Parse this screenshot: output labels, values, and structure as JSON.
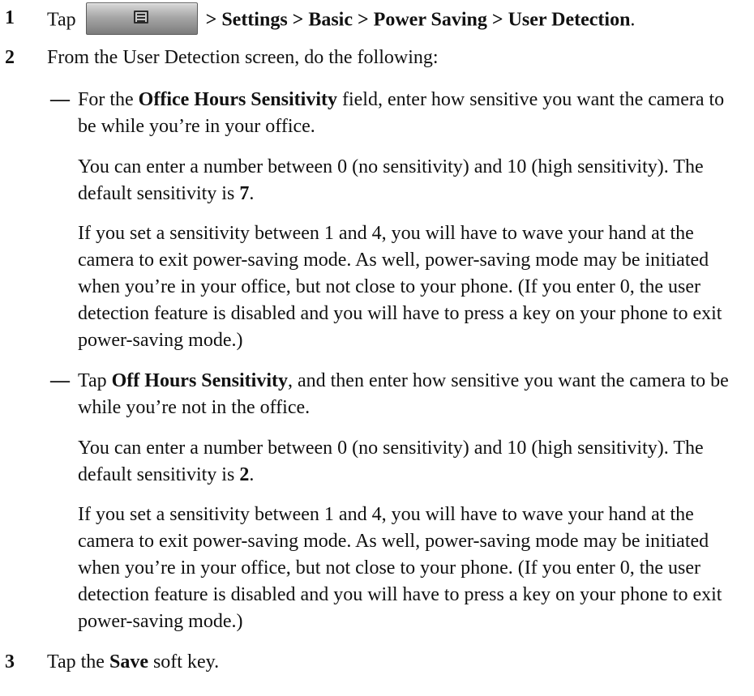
{
  "steps": {
    "s1": {
      "num": "1",
      "tap": "Tap",
      "path": "> Settings > Basic > Power Saving > User Detection",
      "end": ".",
      "button_icon": "menu-list-icon"
    },
    "s2": {
      "num": "2",
      "text": "From the User Detection screen, do the following:"
    },
    "s3": {
      "num": "3",
      "pre": "Tap the",
      "bold": "Save",
      "post": "soft key."
    }
  },
  "bullets": {
    "office": {
      "dash": "—",
      "pre": "For the",
      "bold": "Office Hours Sensitivity",
      "post": "field, enter how sensitive you want the camera to be while you’re in your office.",
      "range_pre": "You can enter a number between 0 (no sensitivity) and 10 (high sensitivity). The default sensitivity is",
      "default": "7",
      "range_end": ".",
      "note": "If you set a sensitivity between 1 and 4, you will have to wave your hand at the camera to exit power-saving mode. As well, power-saving mode may be initiated when you’re in your office, but not close to your phone. (If you enter 0, the user detection feature is disabled and you will have to press a key on your phone to exit power-saving mode.)"
    },
    "off": {
      "dash": "—",
      "pre": "Tap",
      "bold": "Off Hours Sensitivity",
      "post": ", and then enter how sensitive you want the camera to be while you’re not in the office.",
      "range_pre": "You can enter a number between 0 (no sensitivity) and 10 (high sensitivity). The default sensitivity is",
      "default": "2",
      "range_end": ".",
      "note": "If you set a sensitivity between 1 and 4, you will have to wave your hand at the camera to exit power-saving mode. As well, power-saving mode may be initiated when you’re in your office, but not close to your phone. (If you enter 0, the user detection feature is disabled and you will have to press a key on your phone to exit power-saving mode.)"
    }
  }
}
